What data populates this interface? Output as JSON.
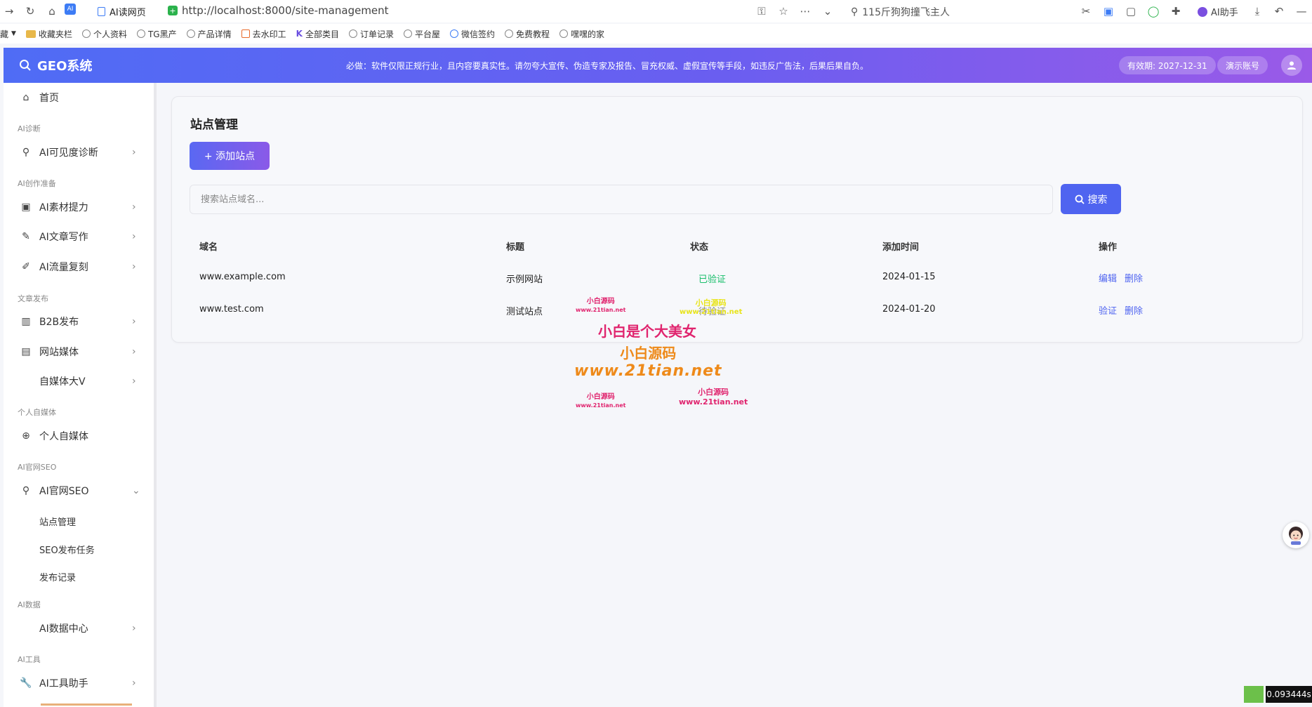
{
  "browser": {
    "tab_title": "AI读网页",
    "url": "http://localhost:8000/site-management",
    "search_hint": "115斤狗狗撞飞主人",
    "ai_assistant": "AI助手",
    "bookmarks": [
      "藏",
      "收藏夹栏",
      "个人资料",
      "TG黑产",
      "产品详情",
      "去水印工",
      "全部类目",
      "订单记录",
      "平台屋",
      "微信签约",
      "免费教程",
      "嘿嘿的家"
    ]
  },
  "header": {
    "logo": "GEO系统",
    "notice": "必做：软件仅限正规行业，且内容要真实性。请勿夸大宣传、伪造专家及报告、冒充权威、虚假宣传等手段，如违反广告法，后果后果自负。",
    "expiry": "有效期: 2027-12-31",
    "demo_account": "演示账号"
  },
  "sidebar": {
    "home": "首页",
    "group_diag": "AI诊断",
    "visibility": "AI可见度诊断",
    "group_prep": "AI创作准备",
    "material": "AI素材提力",
    "writing": "AI文章写作",
    "traffic": "AI流量复刻",
    "group_publish": "文章发布",
    "b2b": "B2B发布",
    "site_media": "网站媒体",
    "self_media_v": "自媒体大V",
    "group_personal": "个人自媒体",
    "personal_media": "个人自媒体",
    "group_seo": "AI官网SEO",
    "seo": "AI官网SEO",
    "site_mgmt": "站点管理",
    "seo_tasks": "SEO发布任务",
    "publish_log": "发布记录",
    "group_data": "AI数据",
    "data_center": "AI数据中心",
    "group_tools": "AI工具",
    "tools_helper": "AI工具助手"
  },
  "main": {
    "title": "站点管理",
    "add_button": "+ 添加站点",
    "search_placeholder": "搜索站点域名...",
    "search_button": "搜索",
    "columns": [
      "域名",
      "标题",
      "状态",
      "添加时间",
      "操作"
    ],
    "rows": [
      {
        "domain": "www.example.com",
        "title": "示例网站",
        "status": "已验证",
        "date": "2024-01-15",
        "action1": "编辑",
        "action2": "删除"
      },
      {
        "domain": "www.test.com",
        "title": "测试站点",
        "status": "待验证",
        "date": "2024-01-20",
        "action1": "验证",
        "action2": "删除"
      }
    ]
  },
  "watermarks": {
    "small_cn": "小白源码",
    "small_url": "www.21tian.net",
    "big_cn": "小白是个大美女",
    "mid_cn": "小白源码",
    "mid_url": "www.21tian.net"
  },
  "timer": "0.093444s"
}
